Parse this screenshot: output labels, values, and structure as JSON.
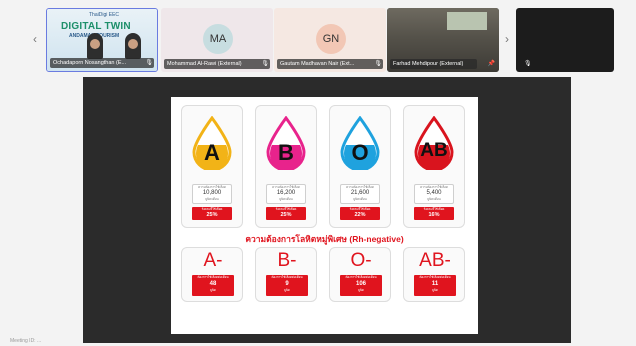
{
  "participants": [
    {
      "name": "Ochadaporn Nosangthan (E...",
      "poster_title": "DIGITAL TWIN",
      "poster_sub": "ANDAMAN TOURISM",
      "logo_text": "ThaiDigi  EEC"
    },
    {
      "name": "Mohammad Al-Rawi (External)",
      "initials": "MA"
    },
    {
      "name": "Gautam Madhavan Nair (Ext...",
      "initials": "GN"
    },
    {
      "name": "Farhad Mehdipour (External)"
    },
    {
      "name": ""
    }
  ],
  "nav": {
    "prev": "‹",
    "next": "›"
  },
  "icons": {
    "mic": "microphone-off-icon",
    "pin": "pin-icon"
  },
  "slide": {
    "blood_types": [
      {
        "type": "A",
        "color": "#f2b317",
        "caption": "ความต้องการใช้เลือด",
        "value": "10,800",
        "unit": "ยูนิต/เดือน",
        "pct_caption": "ร้อยละที่ใช้เลือด",
        "pct": "25%"
      },
      {
        "type": "B",
        "color": "#e8238c",
        "caption": "ความต้องการใช้เลือด",
        "value": "16,200",
        "unit": "ยูนิต/เดือน",
        "pct_caption": "ร้อยละที่ใช้เลือด",
        "pct": "25%"
      },
      {
        "type": "O",
        "color": "#1fa2de",
        "caption": "ความต้องการใช้เลือด",
        "value": "21,600",
        "unit": "ยูนิต/เดือน",
        "pct_caption": "ร้อยละที่ใช้เลือด",
        "pct": "22%"
      },
      {
        "type": "AB",
        "color": "#d9141e",
        "caption": "ความต้องการใช้เลือด",
        "value": "5,400",
        "unit": "ยูนิต/เดือน",
        "pct_caption": "ร้อยละที่ใช้เลือด",
        "pct": "16%"
      }
    ],
    "rh_title": "ความต้องการโลหิตหมู่พิเศษ (Rh-negative)",
    "rh_types": [
      {
        "type": "A-",
        "caption": "ต้องการใช้เลือดต่อเดือน",
        "value": "48",
        "unit": "ยูนิต"
      },
      {
        "type": "B-",
        "caption": "ต้องการใช้เลือดต่อเดือน",
        "value": "9",
        "unit": "ยูนิต"
      },
      {
        "type": "O-",
        "caption": "ต้องการใช้เลือดต่อเดือน",
        "value": "106",
        "unit": "ยูนิต"
      },
      {
        "type": "AB-",
        "caption": "ต้องการใช้เลือดต่อเดือน",
        "value": "11",
        "unit": "ยูนิต"
      }
    ]
  },
  "footer_text": "Meeting ID: ...",
  "colors": {
    "accent_red": "#e0141e",
    "active_border": "#6a7be0"
  }
}
